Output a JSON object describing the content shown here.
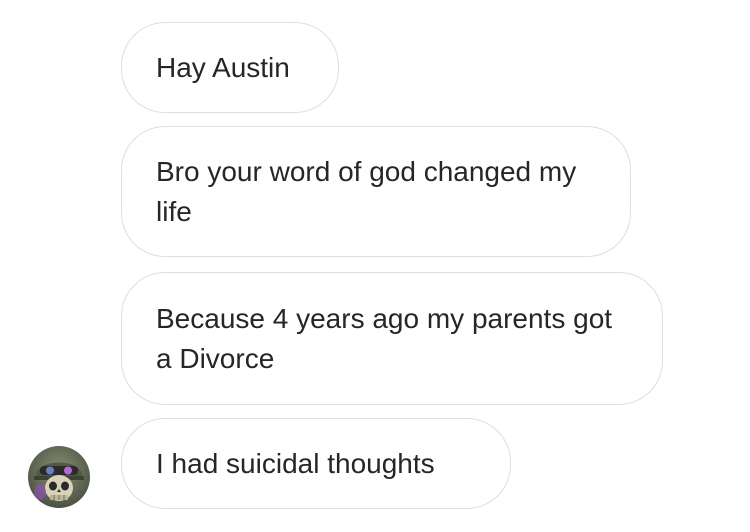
{
  "conversation": {
    "messages": [
      {
        "text": "Hay Austin"
      },
      {
        "text": "Bro your word of god changed my life"
      },
      {
        "text": "Because 4 years ago my parents got a Divorce"
      },
      {
        "text": "I had suicidal thoughts"
      }
    ],
    "sender": {
      "avatar_icon": "skull-avatar-icon"
    }
  },
  "colors": {
    "bubble_border": "#dedede",
    "bubble_text": "#262626",
    "background": "#ffffff"
  }
}
